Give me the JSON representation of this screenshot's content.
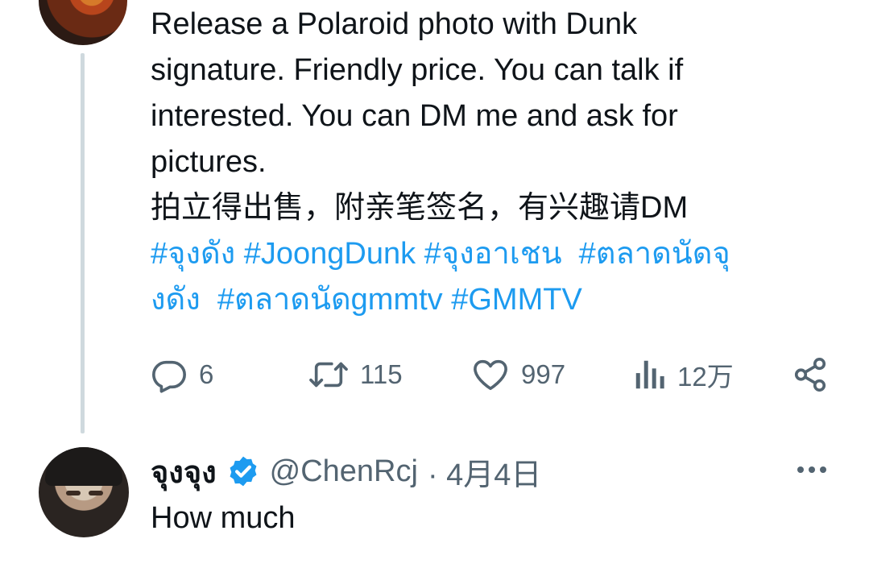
{
  "tweet": {
    "text": "Release a Polaroid photo with Dunk\nsignature. Friendly price. You can talk if\ninterested. You can DM me and ask for\npictures.\n拍立得出售，附亲笔签名，有兴趣请DM",
    "hashtags": "#จุงดัง #JoongDunk #จุงอาเชน  #ตลาดนัดจุ\nงดัง  #ตลาดนัดgmmtv #GMMTV",
    "actions": {
      "reply_count": "6",
      "retweet_count": "115",
      "like_count": "997",
      "views_count": "12万"
    }
  },
  "reply": {
    "display_name": "จุงจุง",
    "handle": "@ChenRcj",
    "date": "· 4月4日",
    "body": "How much"
  },
  "icons": {
    "reply": "comment-icon",
    "retweet": "retweet-icon",
    "like": "heart-icon",
    "views": "analytics-icon",
    "share": "share-icon",
    "verified": "verified-badge-icon",
    "more": "more-dots-icon"
  },
  "colors": {
    "link": "#1d9bf0",
    "muted": "#536471",
    "text": "#0f1419",
    "thread_line": "#cfd9de"
  }
}
